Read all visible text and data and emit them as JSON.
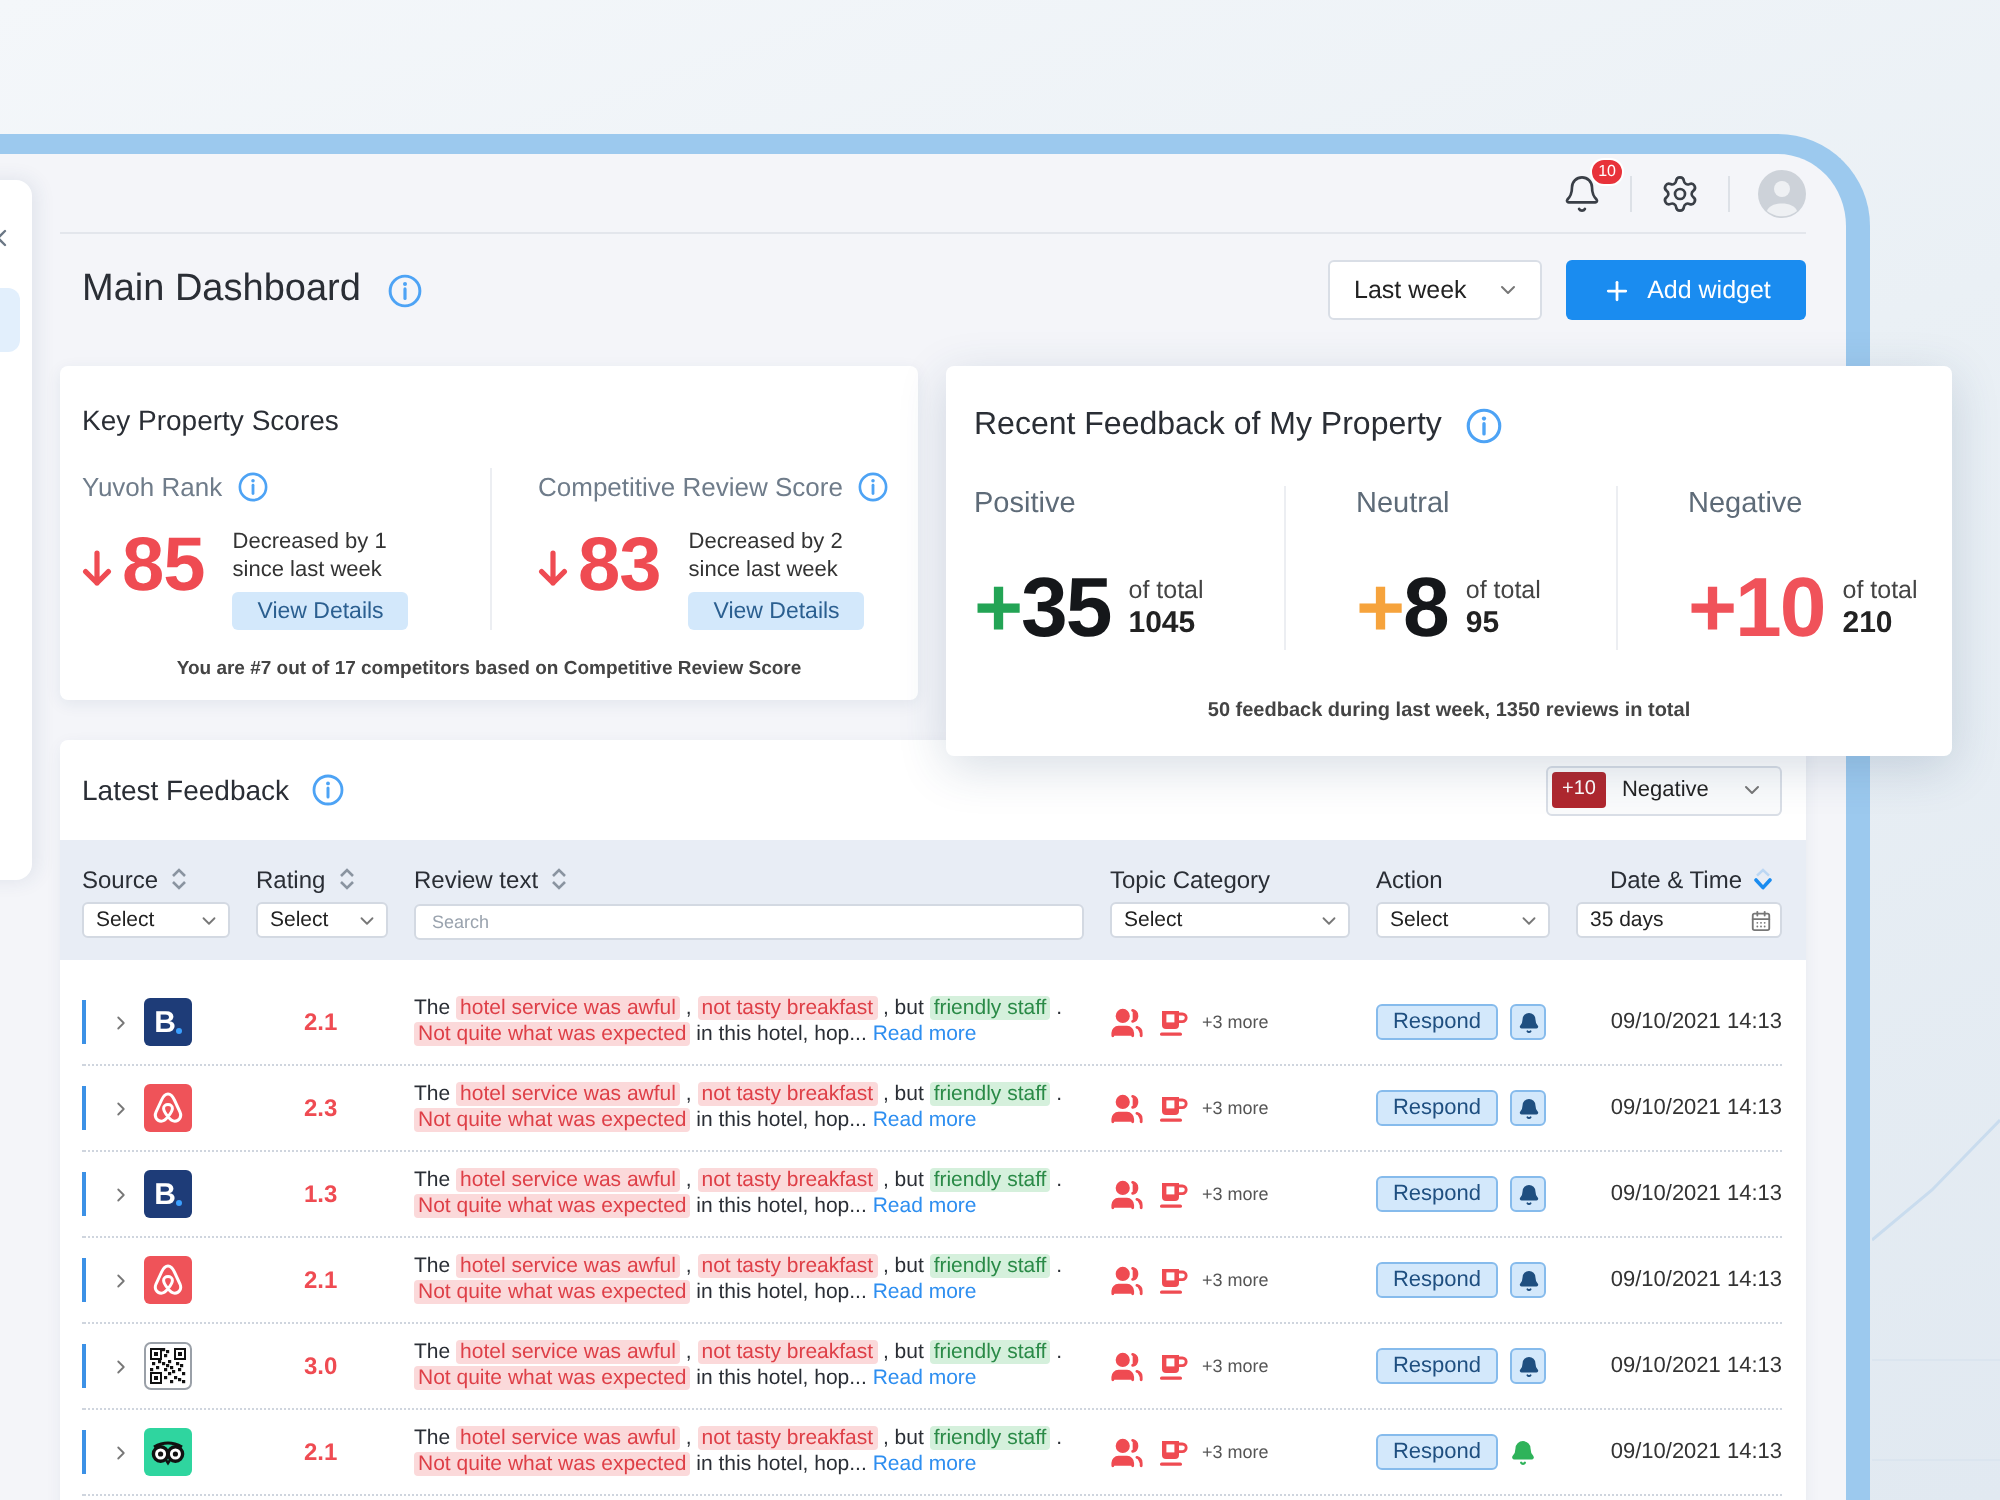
{
  "sidebar": {
    "items": [
      {
        "selected": true
      }
    ]
  },
  "header": {
    "notifications": {
      "count": "10"
    }
  },
  "page": {
    "title": "Main Dashboard",
    "period": "Last week",
    "add_button": "Add widget"
  },
  "key_scores": {
    "title": "Key Property Scores",
    "metrics": [
      {
        "label": "Yuvoh Rank",
        "kind": "decrease",
        "value": "85",
        "change": "Decreased by 1 since last week",
        "button": "View Details"
      },
      {
        "label": "Competitive Review Score",
        "kind": "decrease",
        "value": "83",
        "change": "Decreased by 2 since last week",
        "button": "View Details"
      }
    ],
    "footnote": "You are #7 out of 17 competitors based on Competitive Review Score"
  },
  "recent_feedback": {
    "title": "Recent Feedback of My Property",
    "groups": [
      {
        "kind": "positive",
        "label": "Positive",
        "sign": "+",
        "value": "35",
        "of_total": "of total",
        "total": "1045"
      },
      {
        "kind": "neutral",
        "label": "Neutral",
        "sign": "+",
        "value": "8",
        "of_total": "of total",
        "total": "95"
      },
      {
        "kind": "negative",
        "label": "Negative",
        "sign": "+",
        "value": "10",
        "of_total": "of total",
        "total": "210"
      }
    ],
    "summary": "50 feedback during last week, 1350 reviews in total"
  },
  "latest_feedback": {
    "title": "Latest Feedback",
    "sentiment_filter": {
      "count": "+10",
      "label": "Negative"
    },
    "columns": [
      {
        "label": "Source",
        "sortable": true,
        "selected": false,
        "filter": {
          "kind": "select",
          "value": "Select"
        }
      },
      {
        "label": "Rating",
        "sortable": true,
        "selected": false,
        "filter": {
          "kind": "select",
          "value": "Select"
        }
      },
      {
        "label": "Review text",
        "sortable": true,
        "selected": false,
        "filter": {
          "kind": "search",
          "placeholder": "Search"
        }
      },
      {
        "label": "Topic Category",
        "sortable": false,
        "selected": false,
        "filter": {
          "kind": "select",
          "value": "Select"
        }
      },
      {
        "label": "Action",
        "sortable": false,
        "selected": false,
        "filter": {
          "kind": "select",
          "value": "Select"
        }
      },
      {
        "label": "Date & Time",
        "sortable": true,
        "selected": true,
        "filter": {
          "kind": "date",
          "value": "35 days"
        }
      }
    ],
    "rows": [
      {
        "expanded": false,
        "logo": {
          "kind": "letter",
          "text": "B"
        },
        "rating": "2.1",
        "review": [
          {
            "kind": "plain",
            "text": "The "
          },
          {
            "kind": "negative",
            "text": "hotel service was awful"
          },
          {
            "kind": "plain",
            "text": " , "
          },
          {
            "kind": "negative",
            "text": "not tasty breakfast"
          },
          {
            "kind": "plain",
            "text": " , but "
          },
          {
            "kind": "positive",
            "text": "friendly staff"
          },
          {
            "kind": "plain",
            "text": " . "
          },
          {
            "kind": "negative",
            "text": "Not quite what was expected"
          },
          {
            "kind": "plain",
            "text": " in this hotel, hop..."
          }
        ],
        "read_more": "Read more",
        "more_topics": "+3 more",
        "action": "Respond",
        "notified": false,
        "date": "09/10/2021 14:13"
      },
      {
        "expanded": false,
        "logo": {
          "kind": "loop"
        },
        "rating": "2.3",
        "review": [
          {
            "kind": "plain",
            "text": "The "
          },
          {
            "kind": "negative",
            "text": "hotel service was awful"
          },
          {
            "kind": "plain",
            "text": " , "
          },
          {
            "kind": "negative",
            "text": "not tasty breakfast"
          },
          {
            "kind": "plain",
            "text": " , but "
          },
          {
            "kind": "positive",
            "text": "friendly staff"
          },
          {
            "kind": "plain",
            "text": " . "
          },
          {
            "kind": "negative",
            "text": "Not quite what was expected"
          },
          {
            "kind": "plain",
            "text": " in this hotel, hop..."
          }
        ],
        "read_more": "Read more",
        "more_topics": "+3 more",
        "action": "Respond",
        "notified": false,
        "date": "09/10/2021 14:13"
      },
      {
        "expanded": false,
        "logo": {
          "kind": "letter",
          "text": "B"
        },
        "rating": "1.3",
        "review": [
          {
            "kind": "plain",
            "text": "The "
          },
          {
            "kind": "negative",
            "text": "hotel service was awful"
          },
          {
            "kind": "plain",
            "text": " , "
          },
          {
            "kind": "negative",
            "text": "not tasty breakfast"
          },
          {
            "kind": "plain",
            "text": " , but "
          },
          {
            "kind": "positive",
            "text": "friendly staff"
          },
          {
            "kind": "plain",
            "text": " . "
          },
          {
            "kind": "negative",
            "text": "Not quite what was expected"
          },
          {
            "kind": "plain",
            "text": " in this hotel, hop..."
          }
        ],
        "read_more": "Read more",
        "more_topics": "+3 more",
        "action": "Respond",
        "notified": false,
        "date": "09/10/2021 14:13"
      },
      {
        "expanded": false,
        "logo": {
          "kind": "loop"
        },
        "rating": "2.1",
        "review": [
          {
            "kind": "plain",
            "text": "The "
          },
          {
            "kind": "negative",
            "text": "hotel service was awful"
          },
          {
            "kind": "plain",
            "text": " , "
          },
          {
            "kind": "negative",
            "text": "not tasty breakfast"
          },
          {
            "kind": "plain",
            "text": " , but "
          },
          {
            "kind": "positive",
            "text": "friendly staff"
          },
          {
            "kind": "plain",
            "text": " . "
          },
          {
            "kind": "negative",
            "text": "Not quite what was expected"
          },
          {
            "kind": "plain",
            "text": " in this hotel, hop..."
          }
        ],
        "read_more": "Read more",
        "more_topics": "+3 more",
        "action": "Respond",
        "notified": false,
        "date": "09/10/2021 14:13"
      },
      {
        "expanded": false,
        "logo": {
          "kind": "qr"
        },
        "rating": "3.0",
        "review": [
          {
            "kind": "plain",
            "text": "The "
          },
          {
            "kind": "negative",
            "text": "hotel service was awful"
          },
          {
            "kind": "plain",
            "text": " , "
          },
          {
            "kind": "negative",
            "text": "not tasty breakfast"
          },
          {
            "kind": "plain",
            "text": " , but "
          },
          {
            "kind": "positive",
            "text": "friendly staff"
          },
          {
            "kind": "plain",
            "text": " . "
          },
          {
            "kind": "negative",
            "text": "Not quite what was expected"
          },
          {
            "kind": "plain",
            "text": " in this hotel, hop..."
          }
        ],
        "read_more": "Read more",
        "more_topics": "+3 more",
        "action": "Respond",
        "notified": false,
        "date": "09/10/2021 14:13"
      },
      {
        "expanded": false,
        "logo": {
          "kind": "owl"
        },
        "rating": "2.1",
        "review": [
          {
            "kind": "plain",
            "text": "The "
          },
          {
            "kind": "negative",
            "text": "hotel service was awful"
          },
          {
            "kind": "plain",
            "text": " , "
          },
          {
            "kind": "negative",
            "text": "not tasty breakfast"
          },
          {
            "kind": "plain",
            "text": " , but "
          },
          {
            "kind": "positive",
            "text": "friendly staff"
          },
          {
            "kind": "plain",
            "text": " . "
          },
          {
            "kind": "negative",
            "text": "Not quite what was expected"
          },
          {
            "kind": "plain",
            "text": " in this hotel, hop..."
          }
        ],
        "read_more": "Read more",
        "more_topics": "+3 more",
        "action": "Respond",
        "notified": true,
        "date": "09/10/2021 14:13"
      }
    ]
  }
}
